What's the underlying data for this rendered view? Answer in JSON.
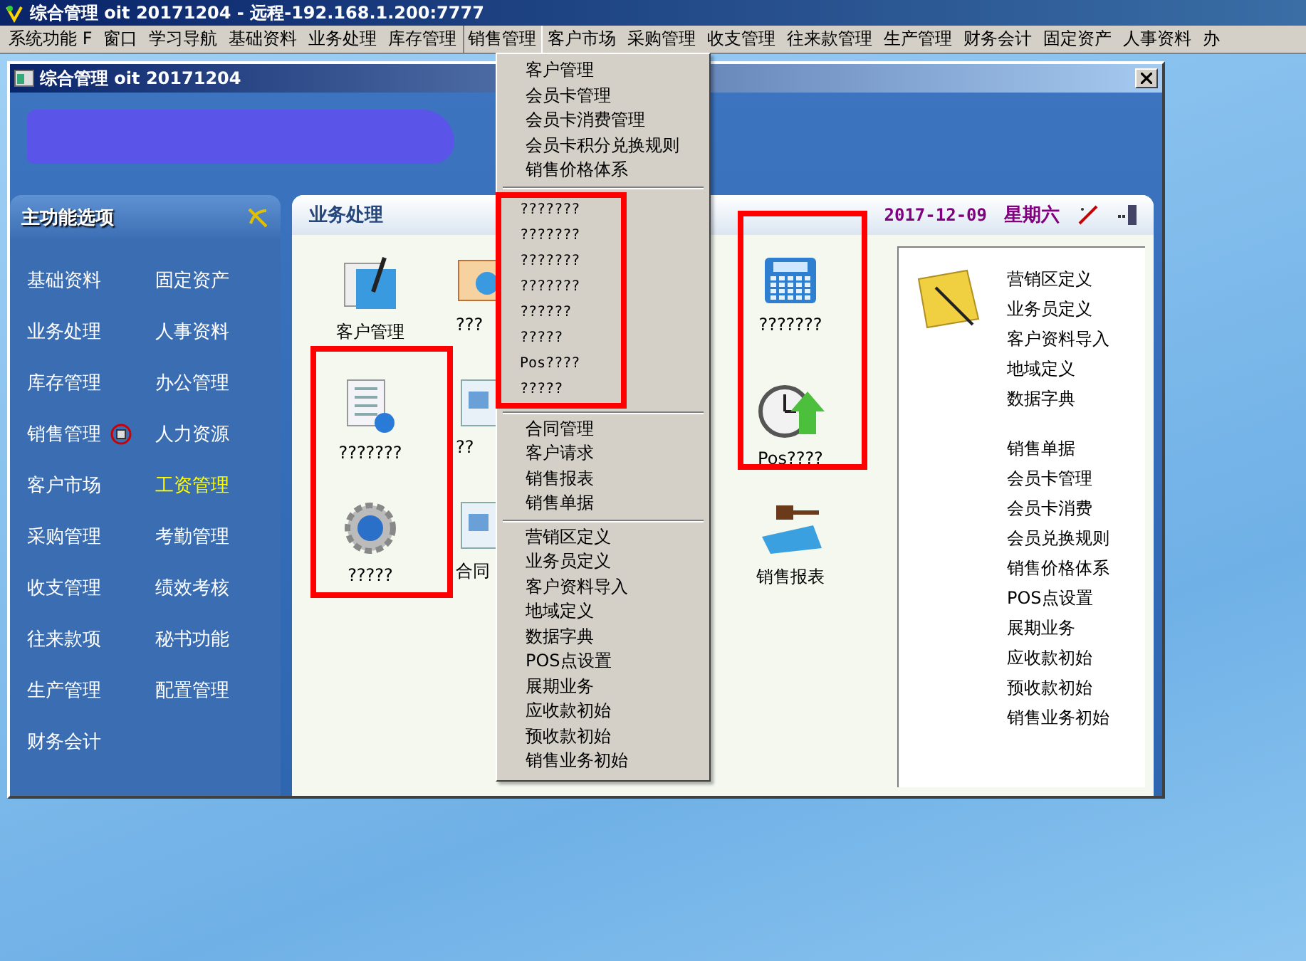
{
  "window": {
    "title": "综合管理 oit 20171204 - 远程-192.168.1.200:7777"
  },
  "menu_bar": [
    {
      "label": "系统功能 F",
      "selected": false
    },
    {
      "label": "窗口",
      "selected": false
    },
    {
      "label": "学习导航",
      "selected": false
    },
    {
      "label": "基础资料",
      "selected": false
    },
    {
      "label": "业务处理",
      "selected": false
    },
    {
      "label": "库存管理",
      "selected": false
    },
    {
      "label": "销售管理",
      "selected": true
    },
    {
      "label": "客户市场",
      "selected": false
    },
    {
      "label": "采购管理",
      "selected": false
    },
    {
      "label": "收支管理",
      "selected": false
    },
    {
      "label": "往来款管理",
      "selected": false
    },
    {
      "label": "生产管理",
      "selected": false
    },
    {
      "label": "财务会计",
      "selected": false
    },
    {
      "label": "固定资产",
      "selected": false
    },
    {
      "label": "人事资料",
      "selected": false
    },
    {
      "label": "办",
      "selected": false
    }
  ],
  "dropdown": {
    "sections": [
      {
        "items": [
          "客户管理",
          "会员卡管理",
          "会员卡消费管理",
          "会员卡积分兑换规则",
          "销售价格体系"
        ]
      },
      {
        "items": [
          "???????",
          "???????",
          "???????",
          "???????",
          "??????",
          "?????",
          "Pos????",
          "?????"
        ]
      },
      {
        "items": [
          "合同管理",
          "客户请求",
          "销售报表",
          "销售单据"
        ]
      },
      {
        "items": [
          "营销区定义",
          "业务员定义",
          "客户资料导入",
          "地域定义",
          "数据字典",
          "POS点设置",
          "展期业务",
          "应收款初始",
          "预收款初始",
          "销售业务初始"
        ]
      }
    ]
  },
  "inner_window": {
    "title": "综合管理 oit 20171204"
  },
  "sidebar": {
    "title": "主功能选项",
    "items": [
      {
        "label": "基础资料",
        "selected": false,
        "hovered": false
      },
      {
        "label": "固定资产",
        "selected": false,
        "hovered": false
      },
      {
        "label": "业务处理",
        "selected": false,
        "hovered": false
      },
      {
        "label": "人事资料",
        "selected": false,
        "hovered": false
      },
      {
        "label": "库存管理",
        "selected": false,
        "hovered": false
      },
      {
        "label": "办公管理",
        "selected": false,
        "hovered": false
      },
      {
        "label": "销售管理",
        "selected": true,
        "hovered": false
      },
      {
        "label": "人力资源",
        "selected": false,
        "hovered": false
      },
      {
        "label": "客户市场",
        "selected": false,
        "hovered": false
      },
      {
        "label": "工资管理",
        "selected": false,
        "hovered": true
      },
      {
        "label": "采购管理",
        "selected": false,
        "hovered": false
      },
      {
        "label": "考勤管理",
        "selected": false,
        "hovered": false
      },
      {
        "label": "收支管理",
        "selected": false,
        "hovered": false
      },
      {
        "label": "绩效考核",
        "selected": false,
        "hovered": false
      },
      {
        "label": "往来款项",
        "selected": false,
        "hovered": false
      },
      {
        "label": "秘书功能",
        "selected": false,
        "hovered": false
      },
      {
        "label": "生产管理",
        "selected": false,
        "hovered": false
      },
      {
        "label": "配置管理",
        "selected": false,
        "hovered": false
      },
      {
        "label": "财务会计",
        "selected": false,
        "hovered": false
      }
    ]
  },
  "panel": {
    "title": "业务处理",
    "date": "2017-12-09",
    "weekday": "星期六",
    "shortcuts": [
      {
        "label": "客户管理",
        "kind": "form"
      },
      {
        "label": "???",
        "kind": "chart"
      },
      {
        "label": "???????",
        "kind": "calculator"
      },
      {
        "label": "???????",
        "kind": "list"
      },
      {
        "label": "??",
        "kind": "doc"
      },
      {
        "label": "Pos????",
        "kind": "clock"
      },
      {
        "label": "?????",
        "kind": "gear"
      },
      {
        "label": "合同",
        "kind": "doc"
      },
      {
        "label": "销售报表",
        "kind": "report"
      }
    ],
    "links": [
      [
        "营销区定义",
        "业务员定义",
        "客户资料导入",
        "地域定义",
        "数据字典"
      ],
      [
        "销售单据",
        "会员卡管理",
        "会员卡消费",
        "会员兑换规则",
        "销售价格体系",
        "POS点设置",
        "展期业务",
        "应收款初始",
        "预收款初始",
        "销售业务初始"
      ]
    ]
  }
}
